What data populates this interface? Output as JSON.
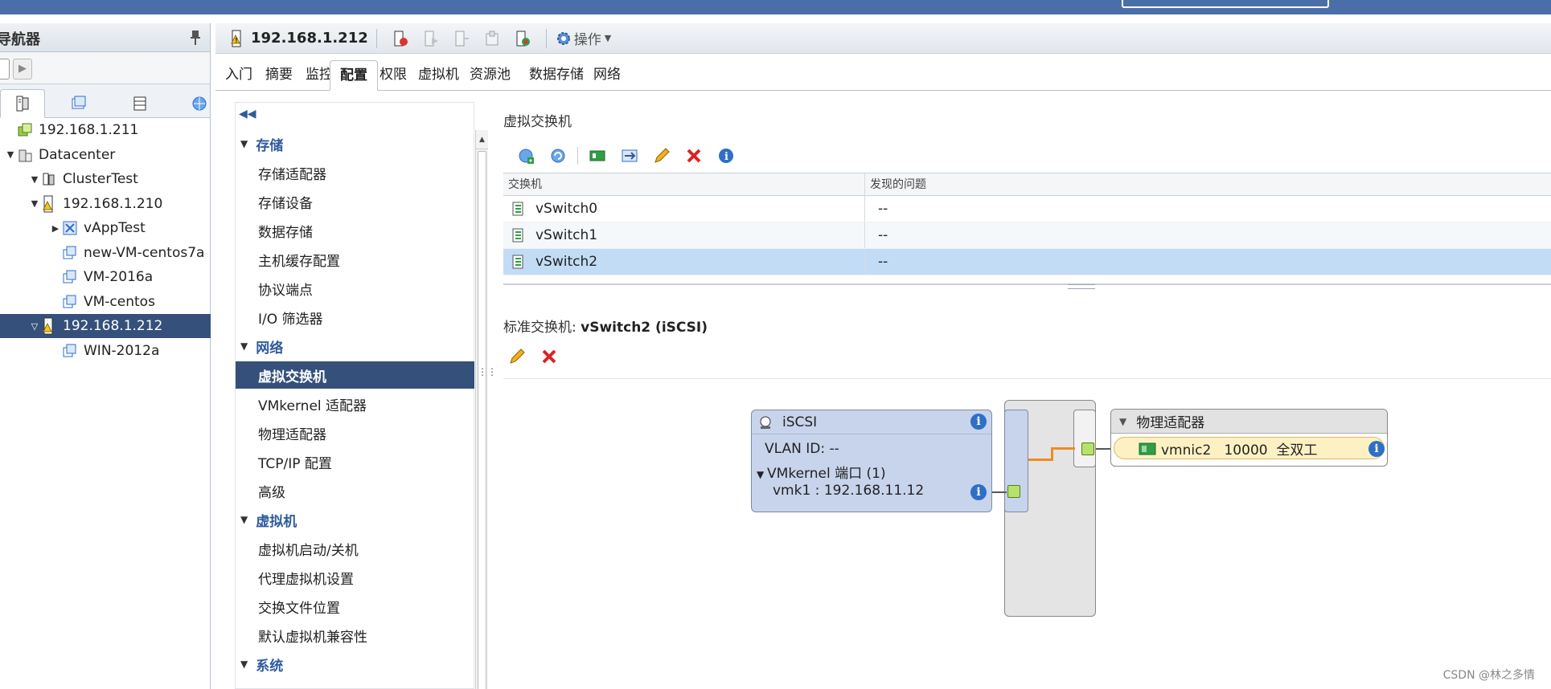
{
  "navigator": {
    "title": "导航器",
    "tree": [
      {
        "label": "192.168.1.211",
        "icon": "vcenter-icon",
        "level": 0,
        "arrow": ""
      },
      {
        "label": "Datacenter",
        "icon": "datacenter-icon",
        "level": 0,
        "arrow": "▼"
      },
      {
        "label": "ClusterTest",
        "icon": "cluster-icon",
        "level": 1,
        "arrow": "▼"
      },
      {
        "label": "192.168.1.210",
        "icon": "host-warning-icon",
        "level": 1,
        "arrow": "▼"
      },
      {
        "label": "vAppTest",
        "icon": "vapp-icon",
        "level": 2,
        "arrow": "▶"
      },
      {
        "label": "new-VM-centos7a",
        "icon": "vm-icon",
        "level": 2,
        "arrow": ""
      },
      {
        "label": "VM-2016a",
        "icon": "vm-icon",
        "level": 2,
        "arrow": ""
      },
      {
        "label": "VM-centos",
        "icon": "vm-icon",
        "level": 2,
        "arrow": ""
      },
      {
        "label": "192.168.1.212",
        "icon": "host-warning-icon",
        "level": 1,
        "arrow": "▽",
        "selected": true
      },
      {
        "label": "WIN-2012a",
        "icon": "vm-icon",
        "level": 2,
        "arrow": ""
      }
    ]
  },
  "header": {
    "host": "192.168.1.212",
    "actions_label": "操作"
  },
  "tabs": [
    "入门",
    "摘要",
    "监控",
    "配置",
    "权限",
    "虚拟机",
    "资源池",
    "数据存储",
    "网络"
  ],
  "active_tab": "配置",
  "config_menu": {
    "items": [
      {
        "label": "存储",
        "section": true
      },
      {
        "label": "存储适配器"
      },
      {
        "label": "存储设备"
      },
      {
        "label": "数据存储"
      },
      {
        "label": "主机缓存配置"
      },
      {
        "label": "协议端点"
      },
      {
        "label": "I/O 筛选器"
      },
      {
        "label": "网络",
        "section": true
      },
      {
        "label": "虚拟交换机",
        "selected": true
      },
      {
        "label": "VMkernel 适配器"
      },
      {
        "label": "物理适配器"
      },
      {
        "label": "TCP/IP 配置"
      },
      {
        "label": "高级"
      },
      {
        "label": "虚拟机",
        "section": true
      },
      {
        "label": "虚拟机启动/关机"
      },
      {
        "label": "代理虚拟机设置"
      },
      {
        "label": "交换文件位置"
      },
      {
        "label": "默认虚拟机兼容性"
      },
      {
        "label": "系统",
        "section": true
      }
    ]
  },
  "vswitch_panel": {
    "title": "虚拟交换机",
    "col_switch": "交换机",
    "col_issues": "发现的问题",
    "rows": [
      {
        "name": "vSwitch0",
        "issues": "--"
      },
      {
        "name": "vSwitch1",
        "issues": "--"
      },
      {
        "name": "vSwitch2",
        "issues": "--",
        "selected": true
      }
    ]
  },
  "standard_switch": {
    "title_prefix": "标准交换机:",
    "title_name": "vSwitch2 (iSCSI)"
  },
  "topology": {
    "portgroup_name": "iSCSI",
    "vlan": "VLAN ID: --",
    "vmkernel_ports": "VMkernel 端口 (1)",
    "vmk": "vmk1 : 192.168.11.12",
    "physical_title": "物理适配器",
    "nic": "vmnic2   10000  全双工"
  },
  "watermark": "CSDN @林之多情",
  "colors": {
    "selection_dark": "#35507a",
    "selection_light": "#c2dcf5",
    "link_blue": "#2f5b9c",
    "wire_orange": "#f08a24",
    "port_green": "#b6e26a"
  }
}
